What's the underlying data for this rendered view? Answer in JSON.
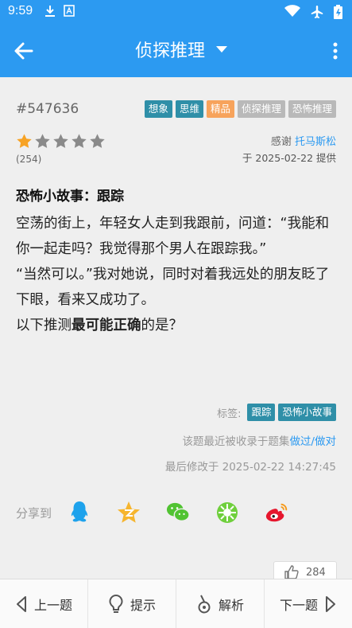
{
  "status": {
    "time": "9:59"
  },
  "header": {
    "title": "侦探推理"
  },
  "question": {
    "id": "#547636",
    "tags": [
      {
        "label": "想象",
        "color": "#2f8fa8"
      },
      {
        "label": "思维",
        "color": "#2f8fa8"
      },
      {
        "label": "精品",
        "color": "#f7a35c"
      },
      {
        "label": "侦探推理",
        "color": "#b9b9b9"
      },
      {
        "label": "恐怖推理",
        "color": "#b9b9b9"
      }
    ],
    "rating": {
      "value": 1,
      "max": 5,
      "count": "(254)"
    },
    "thanks_prefix": "感谢 ",
    "thanks_user": "托马斯松",
    "provided": "于 2025-02-22 提供",
    "title": "恐怖小故事：跟踪",
    "body_lines": [
      "空荡的街上，年轻女人走到我跟前，问道：“我能和你一起走吗？我觉得那个男人在跟踪我。”",
      "“当然可以。”我对她说，同时对着我远处的朋友眨了下眼，看来又成功了。"
    ],
    "ask_prefix": "以下推测",
    "ask_bold": "最可能正确",
    "ask_suffix": "的是？"
  },
  "meta": {
    "labels_title": "标签:",
    "labels": [
      {
        "label": "跟踪",
        "color": "#2f8fa8"
      },
      {
        "label": "恐怖小故事",
        "color": "#2f8fa8"
      }
    ],
    "included_prefix": "该题最近被收录于题集",
    "included_link": "做过/做对",
    "modified": "最后修改于 2025-02-22 14:27:45"
  },
  "share": {
    "label": "分享到",
    "icons": [
      "qq-icon",
      "qzone-icon",
      "wechat-icon",
      "moments-icon",
      "weibo-icon"
    ]
  },
  "like": {
    "count": "284"
  },
  "bottom_nav": {
    "prev": "上一题",
    "hint": "提示",
    "explain": "解析",
    "next": "下一题"
  },
  "colors": {
    "primary": "#2c9af1",
    "star_on": "#f7a325",
    "star_off": "#8a8a8a"
  }
}
